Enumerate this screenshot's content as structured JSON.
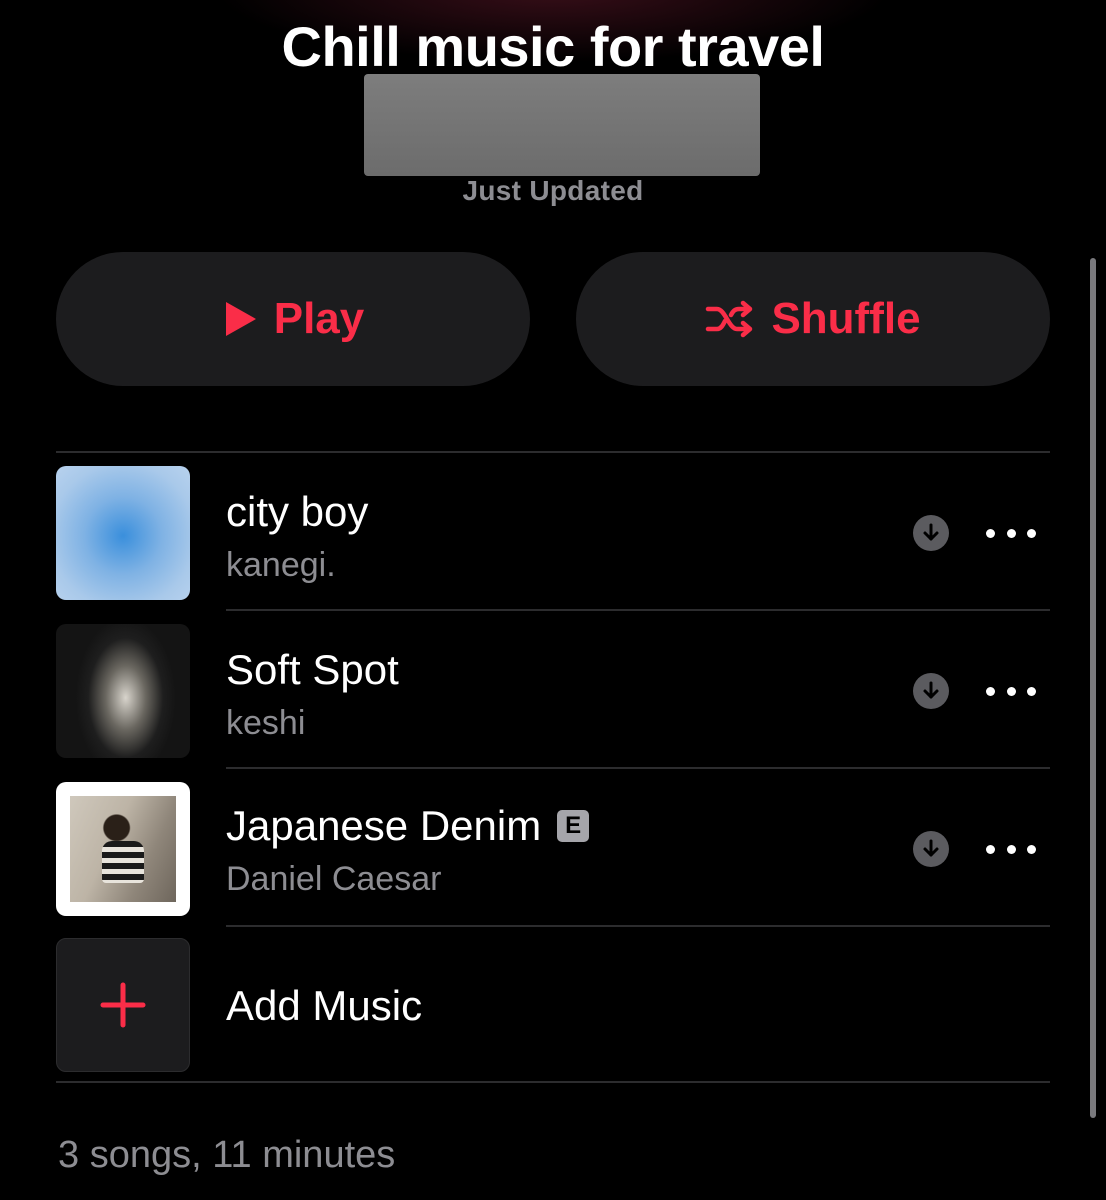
{
  "playlist": {
    "title": "Chill music for travel",
    "updated": "Just Updated"
  },
  "actions": {
    "play_label": "Play",
    "shuffle_label": "Shuffle"
  },
  "songs": [
    {
      "title": "city boy",
      "artist": "kanegi.",
      "explicit": false
    },
    {
      "title": "Soft Spot",
      "artist": "keshi",
      "explicit": false
    },
    {
      "title": "Japanese Denim",
      "artist": "Daniel Caesar",
      "explicit": true,
      "explicit_badge": "E"
    }
  ],
  "add_music_label": "Add Music",
  "summary": "3 songs, 11 minutes",
  "colors": {
    "accent": "#fa2d48",
    "background": "#000000",
    "button_bg": "#1c1c1e",
    "secondary_text": "#8d8d92"
  },
  "icons": {
    "play": "play-icon",
    "shuffle": "shuffle-icon",
    "download": "download-icon",
    "more": "more-icon",
    "add": "plus-icon"
  }
}
